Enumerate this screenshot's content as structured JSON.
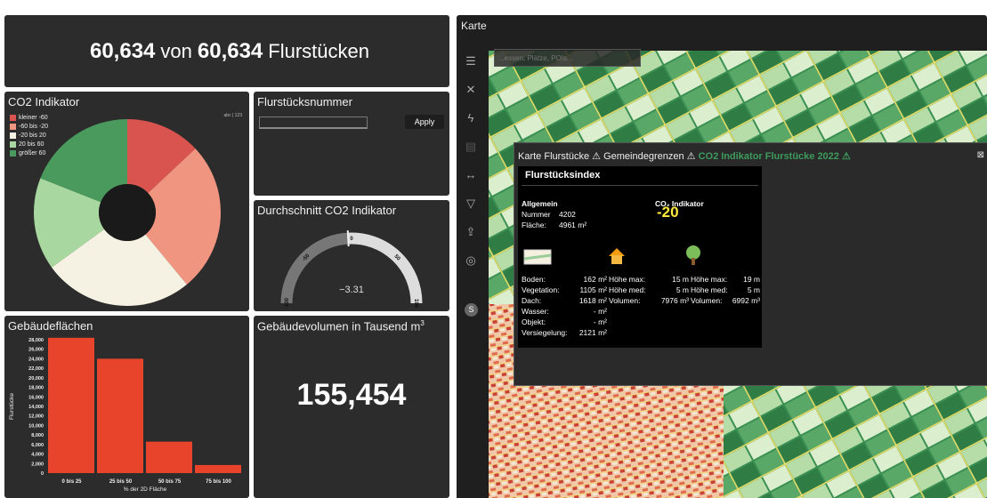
{
  "total": {
    "count": "60,634",
    "of": "von",
    "total": "60,634",
    "unit": "Flurstücken"
  },
  "co2": {
    "title": "CO2 Indikator",
    "legend": [
      {
        "label": "kleiner -60",
        "color": "#d9534f"
      },
      {
        "label": "-60 bis -20",
        "color": "#f09580"
      },
      {
        "label": "-20 bis 20",
        "color": "#f5f2e3"
      },
      {
        "label": "20 bis 60",
        "color": "#a8d8a0"
      },
      {
        "label": "größer 60",
        "color": "#4a9a5e"
      }
    ],
    "abc_label": "abc | 123"
  },
  "chart_data": [
    {
      "type": "pie",
      "title": "CO2 Indikator",
      "labels": [
        "kleiner -60",
        "-60 bis -20",
        "-20 bis 20",
        "20 bis 60",
        "größer 60"
      ],
      "values": [
        13,
        26,
        26,
        16,
        19
      ],
      "colors": [
        "#d9534f",
        "#f09580",
        "#f5f2e3",
        "#a8d8a0",
        "#4a9a5e"
      ]
    },
    {
      "type": "bar",
      "title": "Gebäudeflächen",
      "categories": [
        "0 bis 25",
        "25 bis 50",
        "50 bis 75",
        "75 bis 100"
      ],
      "values": [
        28400,
        24000,
        6600,
        1700
      ],
      "xlabel": "% der 2D Fläche",
      "ylabel": "Flurstücke",
      "ylim": [
        0,
        28000
      ],
      "yticks": [
        "0",
        "2,000",
        "4,000",
        "6,000",
        "8,000",
        "10,000",
        "12,000",
        "14,000",
        "16,000",
        "18,000",
        "20,000",
        "22,000",
        "24,000",
        "26,000",
        "28,000"
      ],
      "color": "#e8442c"
    }
  ],
  "flurstueck": {
    "title": "Flurstücksnummer",
    "input_value": "",
    "apply": "Apply"
  },
  "avg": {
    "title": "Durchschnitt CO2 Indikator",
    "value": "−3.31",
    "ticks": [
      "-100",
      "-50",
      "0",
      "50",
      "100"
    ],
    "gauge_value": -3.31,
    "gauge_min": -100,
    "gauge_max": 100
  },
  "geb": {
    "title": "Gebäudeflächen"
  },
  "vol": {
    "title": "Gebäudevolumen in Tausend m",
    "sup": "3",
    "value": "155,454"
  },
  "karte": {
    "title": "Karte",
    "search_placeholder": "...essen, Plätze, POIs...",
    "user_initial": "S",
    "popup": {
      "layer1": "Karte Flurstücke",
      "layer2": "Gemeindegrenzen",
      "layer3": "CO2 Indikator Flurstücke 2022",
      "card_title": "Flurstücksindex",
      "allgemein": "Allgemein",
      "nummer_label": "Nummer",
      "nummer_value": "4202",
      "flaeche_label": "Fläche:",
      "flaeche_value": "4961 m²",
      "co2_label": "CO₂ Indikator",
      "co2_value": "-20",
      "rows": [
        {
          "label": "Boden:",
          "c1": "162 m²",
          "c2l": "Höhe max:",
          "c2": "15 m",
          "c3l": "Höhe max:",
          "c3": "19 m"
        },
        {
          "label": "Vegetation:",
          "c1": "1105 m²",
          "c2l": "Höhe med:",
          "c2": "5 m",
          "c3l": "Höhe med:",
          "c3": "5 m"
        },
        {
          "label": "Dach:",
          "c1": "1618 m²",
          "c2l": "Volumen:",
          "c2": "7976 m³",
          "c3l": "Volumen:",
          "c3": "6992 m³"
        },
        {
          "label": "Wasser:",
          "c1": "- m²"
        },
        {
          "label": "Objekt:",
          "c1": "- m²"
        },
        {
          "label": "Versiegelung:",
          "c1": "2121 m²"
        }
      ]
    }
  }
}
